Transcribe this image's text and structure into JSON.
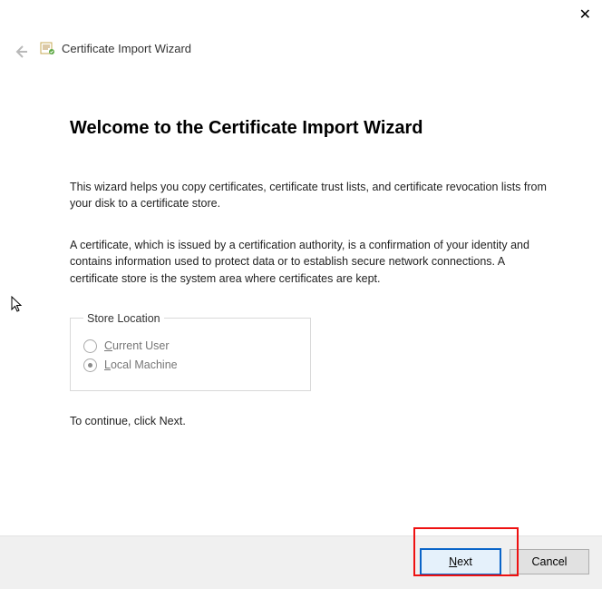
{
  "window": {
    "title": "Certificate Import Wizard",
    "close_glyph": "✕"
  },
  "heading": "Welcome to the Certificate Import Wizard",
  "intro": "This wizard helps you copy certificates, certificate trust lists, and certificate revocation lists from your disk to a certificate store.",
  "explain": "A certificate, which is issued by a certification authority, is a confirmation of your identity and contains information used to protect data or to establish secure network connections. A certificate store is the system area where certificates are kept.",
  "store_location": {
    "legend": "Store Location",
    "options": {
      "current_user": {
        "prefix": "C",
        "rest": "urrent User",
        "selected": false
      },
      "local_machine": {
        "prefix": "L",
        "rest": "ocal Machine",
        "selected": true
      }
    }
  },
  "continue_text": "To continue, click Next.",
  "buttons": {
    "next_prefix": "N",
    "next_rest": "ext",
    "cancel": "Cancel"
  }
}
